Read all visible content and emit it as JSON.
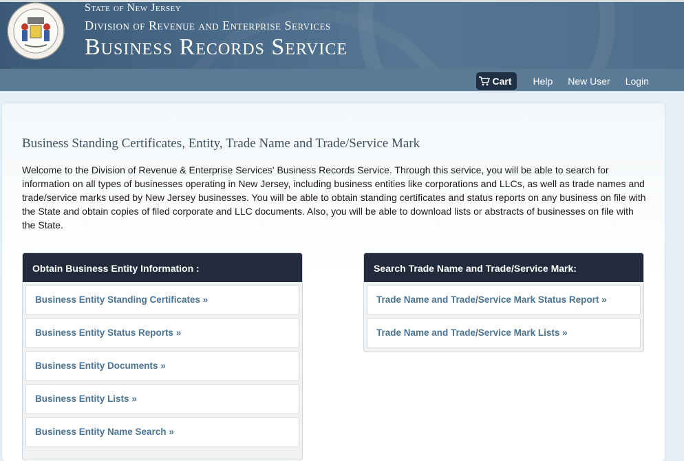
{
  "header": {
    "seal_alt": "State of New Jersey seal",
    "line1": "State of New Jersey",
    "line2": "Division of Revenue and Enterprise Services",
    "line3": "Business Records Service"
  },
  "nav": {
    "cart": "Cart",
    "help": "Help",
    "new_user": "New User",
    "login": "Login"
  },
  "main": {
    "title": "Business Standing Certificates, Entity, Trade Name and Trade/Service Mark",
    "intro": "Welcome to the Division of Revenue & Enterprise Services' Business Records Service. Through this service, you will be able to search for information on all types of businesses operating in New Jersey, including business entities like corporations and LLCs, as well as trade names and trade/service marks used by New Jersey businesses. You will be able to obtain standing certificates and status reports on any business on file with the State and obtain copies of filed corporate and LLC documents. Also, you will be able to download lists or abstracts of businesses on file with the State."
  },
  "entity_panel": {
    "heading": "Obtain Business Entity Information :",
    "items": [
      "Business Entity Standing Certificates »",
      "Business Entity Status Reports »",
      "Business Entity Documents »",
      "Business Entity Lists »",
      "Business Entity Name Search »"
    ]
  },
  "trade_panel": {
    "heading": "Search Trade Name and Trade/Service Mark:",
    "items": [
      "Trade Name and Trade/Service Mark Status Report »",
      "Trade Name and Trade/Service Mark Lists »"
    ]
  }
}
